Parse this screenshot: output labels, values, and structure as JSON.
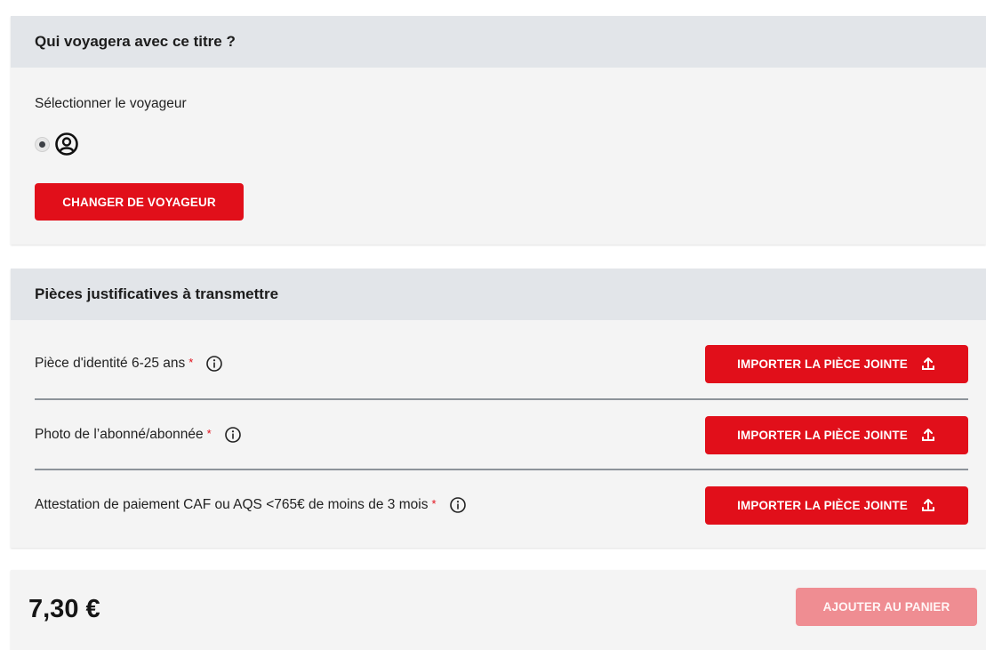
{
  "traveler_section": {
    "title": "Qui voyagera avec ce titre ?",
    "select_label": "Sélectionner le voyageur",
    "radio_icon": "user-circle-icon",
    "change_button": "CHANGER DE VOYAGEUR"
  },
  "documents_section": {
    "title": "Pièces justificatives à transmettre",
    "required_marker": "*",
    "info_icon": "info-circle-icon",
    "upload_icon": "upload-icon",
    "items": [
      {
        "label": "Pièce d'identité 6-25 ans",
        "button": "IMPORTER LA PIÈCE JOINTE"
      },
      {
        "label": "Photo de l’abonné/abonnée",
        "button": "IMPORTER LA PIÈCE JOINTE"
      },
      {
        "label": "Attestation de paiement CAF ou AQS <765€ de moins de 3 mois",
        "button": "IMPORTER LA PIÈCE JOINTE"
      }
    ]
  },
  "footer": {
    "price": "7,30 €",
    "add_to_cart": "AJOUTER AU PANIER",
    "add_to_cart_enabled": false
  },
  "colors": {
    "accent_red": "#e10f1a",
    "disabled_red": "#ef8d92",
    "header_gray": "#e2e5e9",
    "card_bg": "#f4f4f4"
  }
}
